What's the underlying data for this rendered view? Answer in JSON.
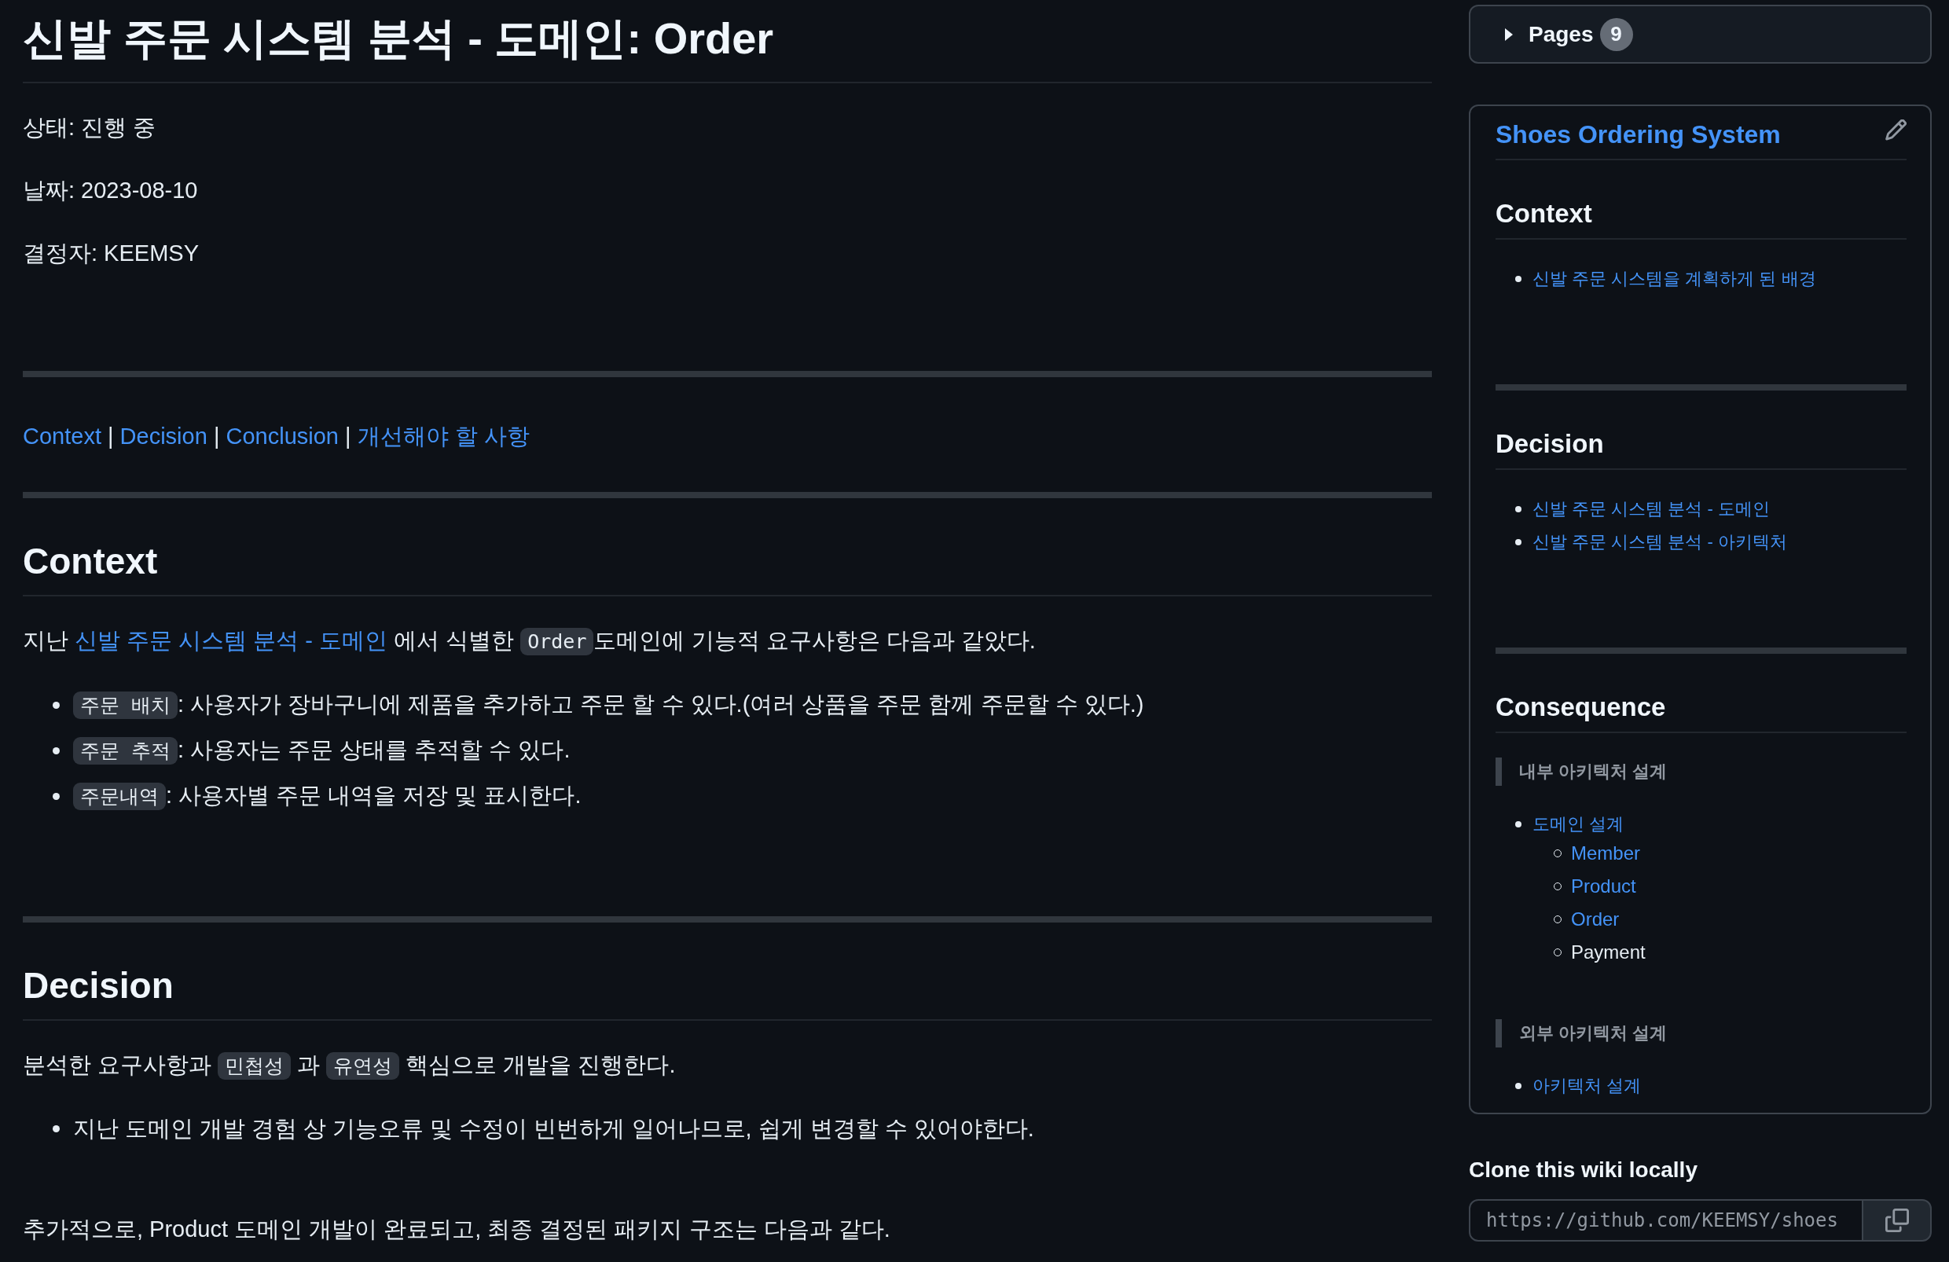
{
  "document": {
    "title": "신발 주문 시스템 분석 - 도메인: Order",
    "meta": [
      "상태: 진행 중",
      "날짜: 2023-08-10",
      "결정자: KEEMSY"
    ],
    "nav": [
      {
        "kind": "link",
        "text": "Context"
      },
      {
        "kind": "text",
        "text": " | "
      },
      {
        "kind": "link",
        "text": "Decision"
      },
      {
        "kind": "text",
        "text": " | "
      },
      {
        "kind": "link",
        "text": "Conclusion"
      },
      {
        "kind": "text",
        "text": " | "
      },
      {
        "kind": "link",
        "text": "개선해야 할 사항"
      }
    ],
    "sections": [
      {
        "heading": "Context",
        "blocks": [
          {
            "kind": "paragraph",
            "segments": [
              {
                "kind": "text",
                "text": "지난 "
              },
              {
                "kind": "link",
                "text": "신발 주문 시스템 분석 - 도메인"
              },
              {
                "kind": "text",
                "text": " 에서 식별한 "
              },
              {
                "kind": "code",
                "text": "Order"
              },
              {
                "kind": "text",
                "text": "도메인에 기능적 요구사항은 다음과 같았다."
              }
            ]
          },
          {
            "kind": "list",
            "items": [
              {
                "segments": [
                  {
                    "kind": "code",
                    "text": "주문 배치"
                  },
                  {
                    "kind": "text",
                    "text": ": 사용자가 장바구니에 제품을 추가하고 주문 할 수 있다.(여러 상품을 주문 함께 주문할 수 있다.)"
                  }
                ]
              },
              {
                "segments": [
                  {
                    "kind": "code",
                    "text": "주문 추적"
                  },
                  {
                    "kind": "text",
                    "text": ": 사용자는 주문 상태를 추적할 수 있다."
                  }
                ]
              },
              {
                "segments": [
                  {
                    "kind": "code",
                    "text": "주문내역"
                  },
                  {
                    "kind": "text",
                    "text": ": 사용자별 주문 내역을 저장 및 표시한다."
                  }
                ]
              }
            ]
          }
        ]
      },
      {
        "heading": "Decision",
        "blocks": [
          {
            "kind": "paragraph",
            "segments": [
              {
                "kind": "text",
                "text": "분석한 요구사항과 "
              },
              {
                "kind": "code",
                "text": "민첩성"
              },
              {
                "kind": "text",
                "text": " 과 "
              },
              {
                "kind": "code",
                "text": "유연성"
              },
              {
                "kind": "text",
                "text": " 핵심으로 개발을 진행한다."
              }
            ]
          },
          {
            "kind": "list",
            "items": [
              {
                "segments": [
                  {
                    "kind": "text",
                    "text": "지난 도메인 개발 경험 상 기능오류 및 수정이 빈번하게 일어나므로, 쉽게 변경할 수 있어야한다."
                  }
                ]
              }
            ]
          },
          {
            "kind": "paragraph",
            "segments": [
              {
                "kind": "text",
                "text": "추가적으로, Product 도메인 개발이 완료되고, 최종 결정된 패키지 구조는 다음과 같다."
              }
            ]
          }
        ]
      }
    ]
  },
  "sidebar": {
    "pages": {
      "label": "Pages",
      "count": "9",
      "expanded": false
    },
    "wiki": {
      "title": "Shoes Ordering System",
      "sections": [
        {
          "heading": "Context",
          "blocks": [
            {
              "kind": "list",
              "items": [
                {
                  "kind": "link",
                  "text": "신발 주문 시스템을 계획하게 된 배경"
                }
              ]
            }
          ]
        },
        {
          "heading": "Decision",
          "blocks": [
            {
              "kind": "list",
              "items": [
                {
                  "kind": "link",
                  "text": "신발 주문 시스템 분석 - 도메인"
                },
                {
                  "kind": "link",
                  "text": "신발 주문 시스템 분석 - 아키텍처"
                }
              ]
            }
          ]
        },
        {
          "heading": "Consequence",
          "blocks": [
            {
              "kind": "quote",
              "text": "내부 아키텍처 설계"
            },
            {
              "kind": "list",
              "items": [
                {
                  "kind": "link",
                  "text": "도메인 설계",
                  "children": [
                    {
                      "kind": "link",
                      "text": "Member"
                    },
                    {
                      "kind": "link",
                      "text": "Product"
                    },
                    {
                      "kind": "link",
                      "text": "Order"
                    },
                    {
                      "kind": "text",
                      "text": "Payment"
                    }
                  ]
                }
              ]
            },
            {
              "kind": "quote",
              "text": "외부 아키텍처 설계"
            },
            {
              "kind": "list",
              "items": [
                {
                  "kind": "link",
                  "text": "아키텍처 설계"
                }
              ]
            }
          ]
        }
      ]
    },
    "clone": {
      "heading": "Clone this wiki locally",
      "url": "https://github.com/KEEMSY/shoes"
    }
  }
}
